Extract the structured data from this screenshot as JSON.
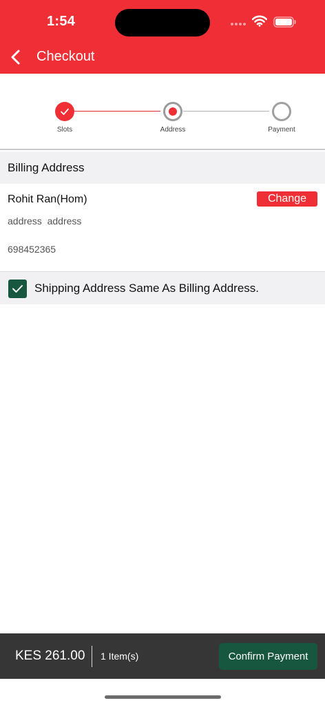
{
  "status_bar": {
    "time": "1:54"
  },
  "header": {
    "title": "Checkout",
    "back_icon": "chevron-left-icon"
  },
  "stepper": {
    "steps": [
      {
        "label": "Slots",
        "state": "done"
      },
      {
        "label": "Address",
        "state": "current"
      },
      {
        "label": "Payment",
        "state": "pending"
      }
    ]
  },
  "billing": {
    "section_title": "Billing Address",
    "name": "Rohit Ran(Hom)",
    "change_label": "Change",
    "address": "address  address",
    "phone": "698452365"
  },
  "shipping": {
    "same_as_billing_label": "Shipping Address Same As Billing Address.",
    "checked": true
  },
  "footer": {
    "total": "KES 261.00",
    "items": "1 Item(s)",
    "confirm_label": "Confirm Payment"
  },
  "colors": {
    "brand_red": "#ef2f35",
    "brand_green": "#18573f",
    "footer_bg": "#363636"
  }
}
